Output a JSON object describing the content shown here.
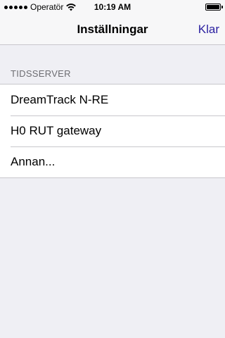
{
  "status_bar": {
    "carrier": "Operatör",
    "time": "10:19 AM",
    "battery_level": 1.0,
    "icons": [
      "signal-icon",
      "wifi-icon",
      "battery-icon"
    ]
  },
  "nav": {
    "title": "Inställningar",
    "done_label": "Klar"
  },
  "section": {
    "header": "TIDSSERVER",
    "items": [
      {
        "label": "DreamTrack N-RE"
      },
      {
        "label": "H0 RUT gateway"
      },
      {
        "label": "Annan..."
      }
    ]
  },
  "colors": {
    "accent": "#2a1fa0",
    "background": "#efeff4",
    "separator": "#c8c7cc"
  }
}
